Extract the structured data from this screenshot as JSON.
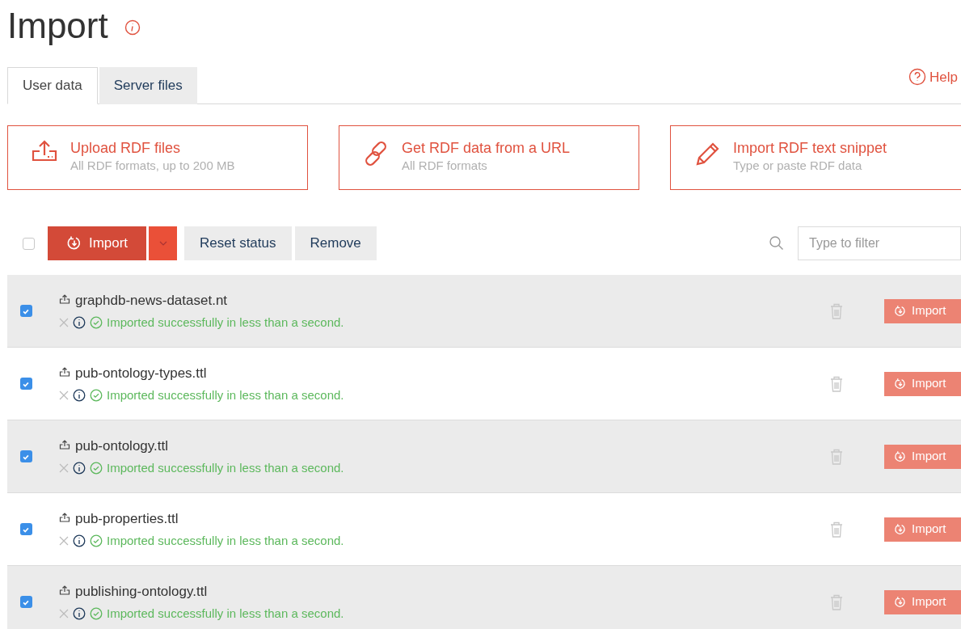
{
  "title": "Import",
  "tabs": [
    {
      "label": "User data",
      "selected": true
    },
    {
      "label": "Server files",
      "selected": false
    }
  ],
  "help": "Help",
  "cards": [
    {
      "kind": "upload",
      "title": "Upload RDF files",
      "subtitle": "All RDF formats, up to 200 MB"
    },
    {
      "kind": "link",
      "title": "Get RDF data from a URL",
      "subtitle": "All RDF formats"
    },
    {
      "kind": "pencil",
      "title": "Import RDF text snippet",
      "subtitle": "Type or paste RDF data"
    }
  ],
  "toolbar": {
    "select_all": {
      "checked": false
    },
    "import": "Import",
    "reset": "Reset status",
    "remove": "Remove",
    "filter": {
      "placeholder": "Type to filter"
    }
  },
  "files": [
    {
      "name": "graphdb-news-dataset.nt",
      "checked": true,
      "status": "Imported successfully in less than a second.",
      "action": "Import"
    },
    {
      "name": "pub-ontology-types.ttl",
      "checked": true,
      "status": "Imported successfully in less than a second.",
      "action": "Import"
    },
    {
      "name": "pub-ontology.ttl",
      "checked": true,
      "status": "Imported successfully in less than a second.",
      "action": "Import"
    },
    {
      "name": "pub-properties.ttl",
      "checked": true,
      "status": "Imported successfully in less than a second.",
      "action": "Import"
    },
    {
      "name": "publishing-ontology.ttl",
      "checked": true,
      "status": "Imported successfully in less than a second.",
      "action": "Import"
    }
  ]
}
